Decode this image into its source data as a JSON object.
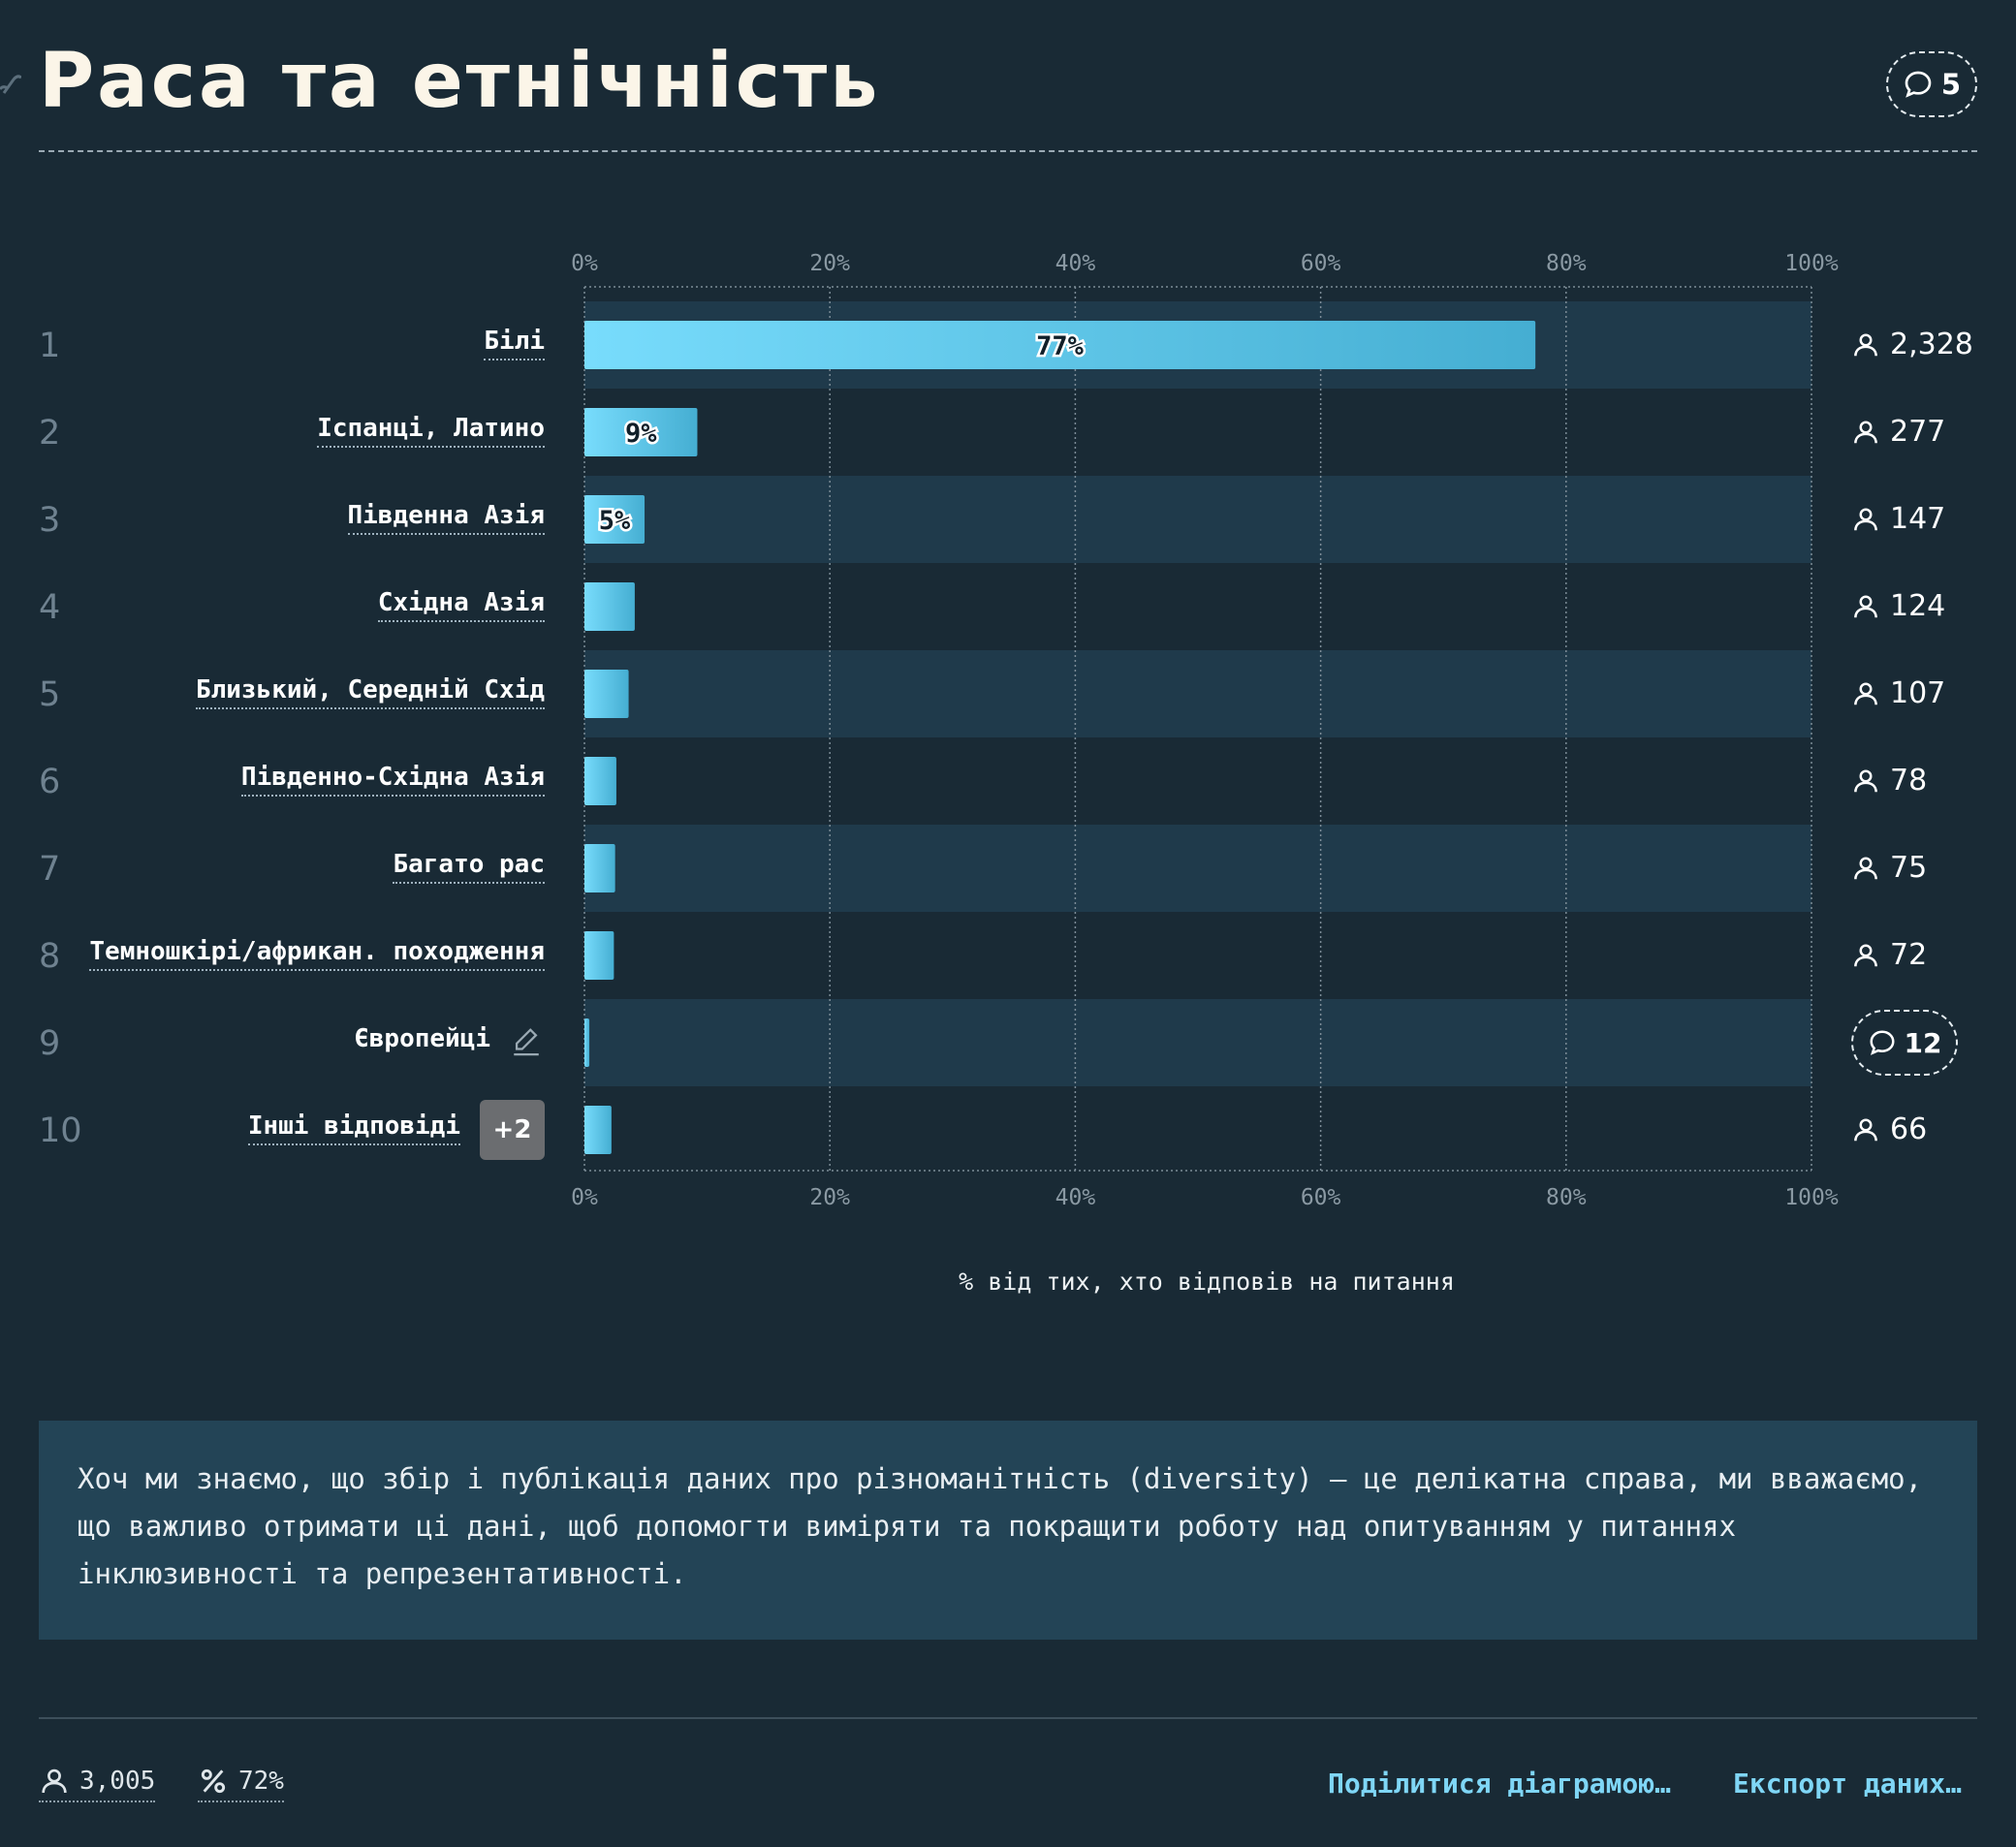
{
  "header": {
    "title": "Раса та етнічність",
    "comment_count": "5"
  },
  "chart_data": {
    "type": "bar",
    "orientation": "horizontal",
    "categories": [
      "Білі",
      "Іспанці, Латино",
      "Південна Азія",
      "Східна Азія",
      "Близький, Середній Схід",
      "Південно-Східна Азія",
      "Багато рас",
      "Темношкірі/африкан. походження",
      "Європейці",
      "Інші відповіді"
    ],
    "ranks": [
      "1",
      "2",
      "3",
      "4",
      "5",
      "6",
      "7",
      "8",
      "9",
      "10"
    ],
    "values": [
      77.5,
      9.2,
      4.9,
      4.1,
      3.6,
      2.6,
      2.5,
      2.4,
      0.4,
      2.2
    ],
    "value_labels": [
      "77%",
      "9%",
      "5%",
      "",
      "",
      "",
      "",
      "",
      "",
      ""
    ],
    "counts": [
      "2,328",
      "277",
      "147",
      "124",
      "107",
      "78",
      "75",
      "72",
      "12",
      "66"
    ],
    "count_kinds": [
      "people",
      "people",
      "people",
      "people",
      "people",
      "people",
      "people",
      "people",
      "comments",
      "people"
    ],
    "extra_badge": "+2",
    "xlim": [
      0,
      100
    ],
    "x_ticks": [
      0,
      20,
      40,
      60,
      80,
      100
    ],
    "x_tick_labels": [
      "0%",
      "20%",
      "40%",
      "60%",
      "80%",
      "100%"
    ],
    "xlabel": "% від тих, хто відповів на питання",
    "grid": true
  },
  "colors": {
    "background": "#192a35",
    "row_stripe": "#1f3a4b",
    "bar_start": "#78dcfc",
    "bar_end": "#45aed2",
    "link": "#7fd6f6",
    "note_background": "#234456"
  },
  "note": {
    "text": "Хоч ми знаємо, що збір і публікація даних про різноманітність (diversity) — це делікатна справа, ми вважаємо,\nщо важливо отримати ці дані, щоб допомогти виміряти та покращити роботу над опитуванням у питаннях\nінклюзивності та репрезентативності."
  },
  "footer": {
    "respondents": "3,005",
    "percent": "72%",
    "share_label": "Поділитися діаграмою…",
    "export_label": "Експорт даних…"
  },
  "icons": {
    "person": "person-icon",
    "comment": "comment-icon",
    "percent": "percent-icon",
    "edit": "pencil-icon",
    "link": "link-icon"
  }
}
